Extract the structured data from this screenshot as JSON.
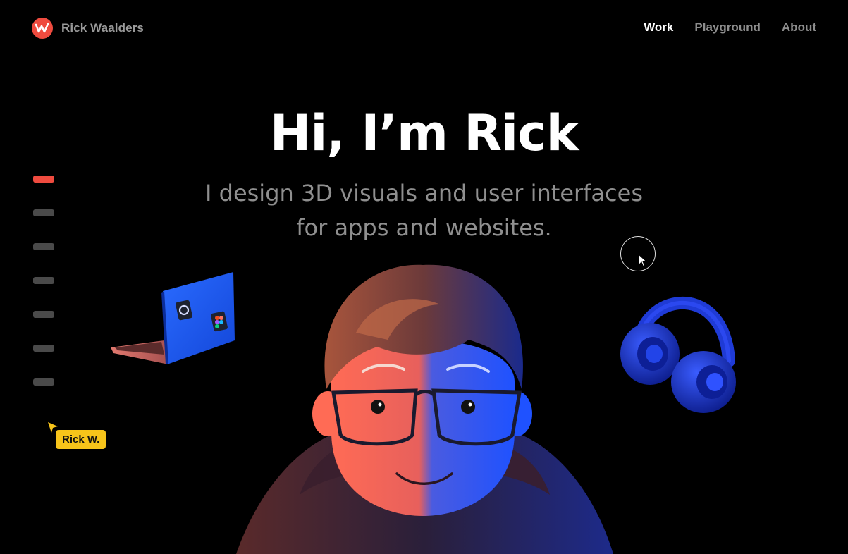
{
  "header": {
    "brand_name": "Rick Waalders",
    "nav": [
      {
        "label": "Work",
        "active": true
      },
      {
        "label": "Playground",
        "active": false
      },
      {
        "label": "About",
        "active": false
      }
    ]
  },
  "hero": {
    "title": "Hi, I’m Rick",
    "subtitle_line1": "I design 3D visuals and user interfaces",
    "subtitle_line2": "for apps and websites."
  },
  "indicators": {
    "count": 7,
    "active_index": 0
  },
  "cursor_tag": {
    "label": "Rick W."
  },
  "icons": [
    "brand-logo-icon",
    "laptop-illustration",
    "headphones-illustration",
    "avatar-illustration",
    "cursor-icon"
  ],
  "colors": {
    "background": "#000000",
    "accent": "#ef4b3f",
    "nav_active": "#ffffff",
    "nav_inactive": "#8d8d8d",
    "subtitle": "#8f8f8f",
    "tag_bg": "#f7c41a"
  }
}
